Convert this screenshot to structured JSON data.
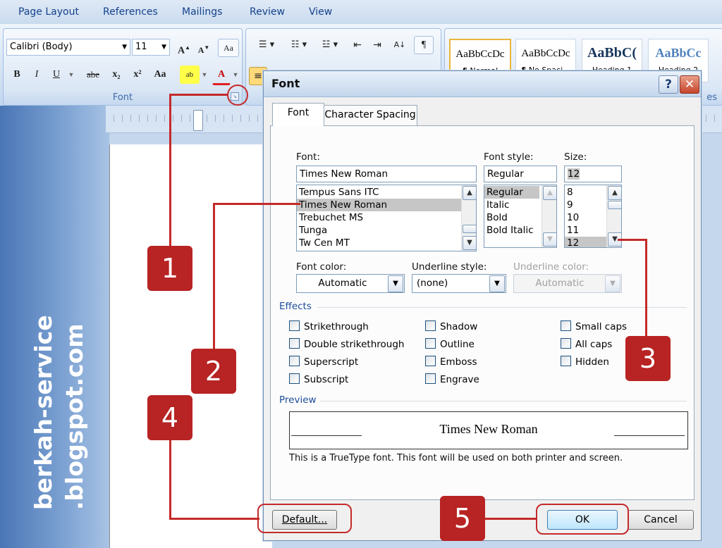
{
  "ribbon": {
    "tabs": [
      "Page Layout",
      "References",
      "Mailings",
      "Review",
      "View"
    ],
    "font_group": {
      "title": "Font",
      "font_name": "Calibri (Body)",
      "font_size": "11",
      "buttons": [
        "B",
        "I",
        "U",
        "abe",
        "x₂",
        "x²",
        "Aa"
      ]
    },
    "styles": [
      {
        "sample": "AaBbCcDc",
        "name": "¶ Normal"
      },
      {
        "sample": "AaBbCcDc",
        "name": "¶ No Spaci..."
      },
      {
        "sample": "AaBbC(",
        "name": "Heading 1"
      },
      {
        "sample": "AaBbCc",
        "name": "Heading 2"
      }
    ],
    "styles_title_fragment": "es"
  },
  "watermark": [
    "berkah-service",
    ".blogspot.com"
  ],
  "dialog": {
    "title": "Font",
    "help": "?",
    "close": "✕",
    "tabs": [
      "Font",
      "Character Spacing"
    ],
    "font_label": "Font:",
    "font_value": "Times New Roman",
    "font_list": [
      "Tempus Sans ITC",
      "Times New Roman",
      "Trebuchet MS",
      "Tunga",
      "Tw Cen MT"
    ],
    "style_label": "Font style:",
    "style_value": "Regular",
    "style_list": [
      "Regular",
      "Italic",
      "Bold",
      "Bold Italic"
    ],
    "size_label": "Size:",
    "size_value": "12",
    "size_list": [
      "8",
      "9",
      "10",
      "11",
      "12"
    ],
    "color_label": "Font color:",
    "color_value": "Automatic",
    "underline_label": "Underline style:",
    "underline_value": "(none)",
    "underline_color_label": "Underline color:",
    "underline_color_value": "Automatic",
    "effects_title": "Effects",
    "effects": {
      "col1": [
        "Strikethrough",
        "Double strikethrough",
        "Superscript",
        "Subscript"
      ],
      "col2": [
        "Shadow",
        "Outline",
        "Emboss",
        "Engrave"
      ],
      "col3": [
        "Small caps",
        "All caps",
        "Hidden"
      ]
    },
    "preview_title": "Preview",
    "preview_text": "Times New Roman",
    "info_text": "This is a TrueType font. This font will be used on both printer and screen.",
    "default_button": "Default...",
    "ok_button": "OK",
    "cancel_button": "Cancel"
  },
  "annotations": [
    "1",
    "2",
    "3",
    "4",
    "5"
  ],
  "colors": {
    "annotation": "#b82323",
    "dialog_bg": "#f0f0f0",
    "ribbon_text": "#15428b"
  }
}
